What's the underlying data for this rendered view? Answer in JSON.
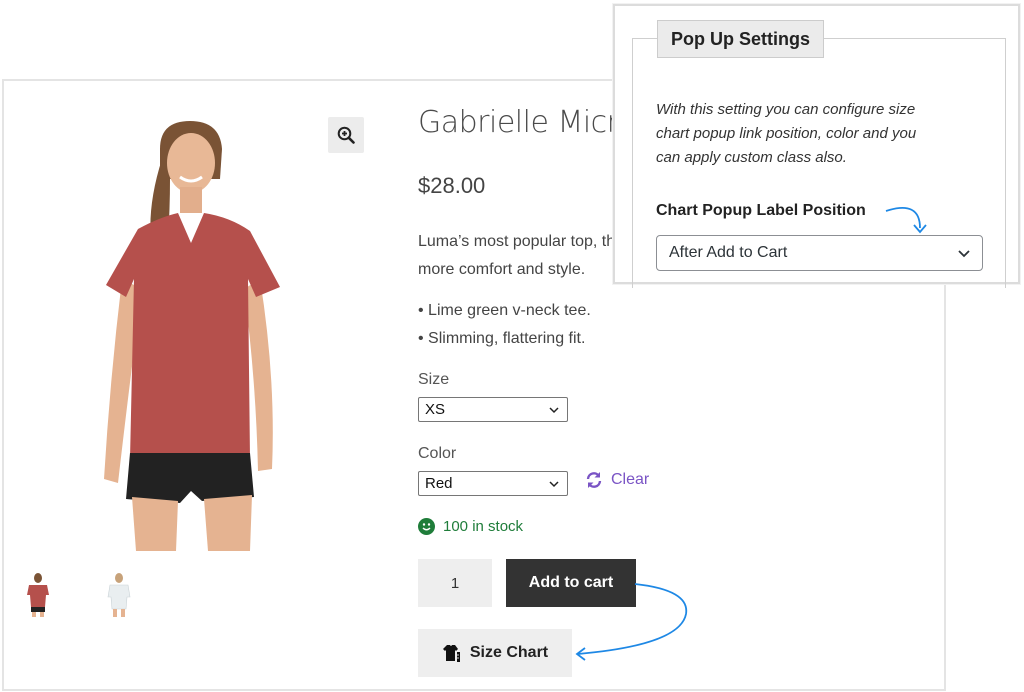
{
  "product": {
    "title": "Gabrielle Micro",
    "price": "$28.00",
    "description": [
      "Luma’s most popular top, th",
      "more comfort and style."
    ],
    "bullets": [
      "• Lime green v-neck tee.",
      "• Slimming, flattering fit."
    ],
    "size_label": "Size",
    "size_value": "XS",
    "color_label": "Color",
    "color_value": "Red",
    "clear_label": "Clear",
    "stock_text": "100 in stock",
    "quantity": "1",
    "add_to_cart_label": "Add to cart",
    "size_chart_label": "Size Chart",
    "colors": {
      "shirt": "#b5504c",
      "stock": "#1f7d3a",
      "clear": "#7a54c5",
      "cart_button": "#333333"
    }
  },
  "icons": {
    "zoom": "magnifier-plus-icon",
    "refresh": "refresh-icon",
    "stock": "smiley-icon",
    "size_chart": "tshirt-ruler-icon",
    "dropdown": "chevron-down-icon"
  },
  "popup": {
    "legend": "Pop Up Settings",
    "description": [
      "With this setting you can configure size",
      "chart popup link position, color and you",
      "can apply custom class also."
    ],
    "field_label": "Chart Popup Label Position",
    "select_value": "After Add to Cart",
    "arrow_color": "#1e88e5"
  }
}
